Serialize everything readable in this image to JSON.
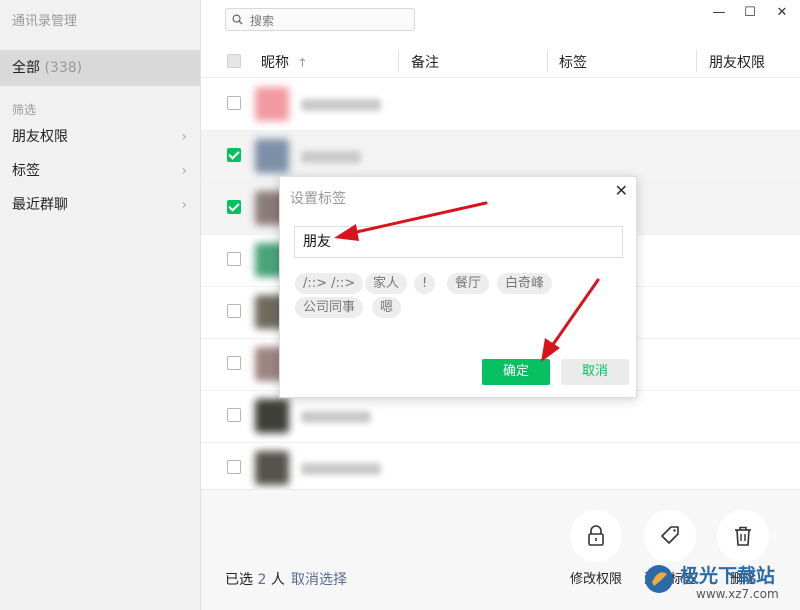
{
  "app_title": "通讯录管理",
  "sidebar": {
    "all_label": "全部",
    "all_count": "(338)",
    "filter_label": "筛选",
    "items": [
      {
        "label": "朋友权限"
      },
      {
        "label": "标签"
      },
      {
        "label": "最近群聊"
      }
    ]
  },
  "search": {
    "placeholder": "搜索"
  },
  "window_controls": {
    "minimize": "—",
    "maximize": "☐",
    "close": "✕"
  },
  "table": {
    "columns": [
      "昵称",
      "备注",
      "标签",
      "朋友权限"
    ],
    "sort_indicator": "↑",
    "rows": [
      {
        "checked": false,
        "avatar_color": "#f09aa0"
      },
      {
        "checked": true,
        "avatar_color": "#7d8fa8"
      },
      {
        "checked": true,
        "avatar_color": "#8b7b7b"
      },
      {
        "checked": false,
        "avatar_color": "#4aa37a"
      },
      {
        "checked": false,
        "avatar_color": "#6f6a5e"
      },
      {
        "checked": false,
        "avatar_color": "#9c8580"
      },
      {
        "checked": false,
        "avatar_color": "#3f3f3a"
      },
      {
        "checked": false,
        "avatar_color": "#55544a"
      }
    ]
  },
  "bottom": {
    "selected_prefix": "已选",
    "selected_count": "2",
    "selected_unit": "人",
    "cancel_select": "取消选择",
    "actions": [
      {
        "label": "修改权限",
        "icon": "lock-icon"
      },
      {
        "label": "添加标签",
        "icon": "tag-icon"
      },
      {
        "label": "删除",
        "icon": "trash-icon"
      }
    ]
  },
  "dialog": {
    "title": "设置标签",
    "close": "✕",
    "input_value": "朋友",
    "tags": [
      "/::> /::>",
      "家人",
      "!",
      "餐厅",
      "白奇峰",
      "公司同事",
      "嗯"
    ],
    "ok_label": "确定",
    "cancel_label": "取消"
  },
  "watermark": {
    "text": "极光下载站",
    "url": "www.xz7.com"
  },
  "colors": {
    "accent_green": "#07c160",
    "link_blue": "#576b95",
    "annotation_red": "#d9131c"
  }
}
